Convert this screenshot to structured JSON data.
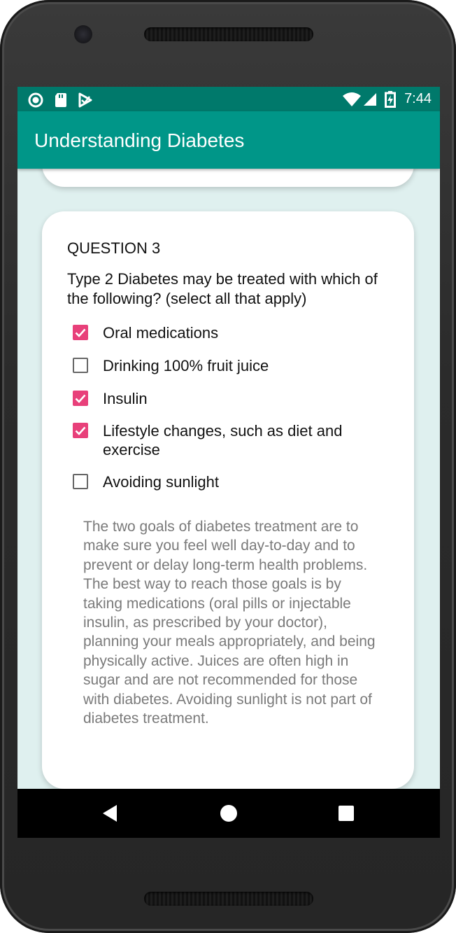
{
  "statusbar": {
    "time": "7:44"
  },
  "appbar": {
    "title": "Understanding Diabetes"
  },
  "question": {
    "number_label": "QUESTION 3",
    "text": "Type 2 Diabetes may be treated with which of the following? (select all that apply)",
    "options": [
      {
        "label": "Oral medications",
        "checked": true
      },
      {
        "label": "Drinking 100% fruit juice",
        "checked": false
      },
      {
        "label": "Insulin",
        "checked": true
      },
      {
        "label": "Lifestyle changes, such as diet and exercise",
        "checked": true
      },
      {
        "label": "Avoiding sunlight",
        "checked": false
      }
    ],
    "explanation": "The two goals of diabetes treatment are to make sure you feel well day-to-day and to prevent or delay long-term health problems. The best way to reach those goals is by taking medications (oral pills or injectable insulin, as prescribed by your doctor), planning your meals appropriately, and being physically active. Juices are often high in sugar and are not recommended for those with diabetes. Avoiding sunlight is not part of diabetes treatment."
  },
  "colors": {
    "status_bar": "#00796b",
    "app_bar": "#009688",
    "background": "#dff0ef",
    "checkbox_accent": "#e8407a"
  },
  "icons": {
    "status_left": [
      "sync-circle-icon",
      "sd-card-icon",
      "download-check-icon"
    ],
    "status_right": [
      "wifi-icon",
      "signal-icon",
      "battery-charging-icon"
    ],
    "nav": [
      "back-icon",
      "home-icon",
      "recents-icon"
    ]
  }
}
